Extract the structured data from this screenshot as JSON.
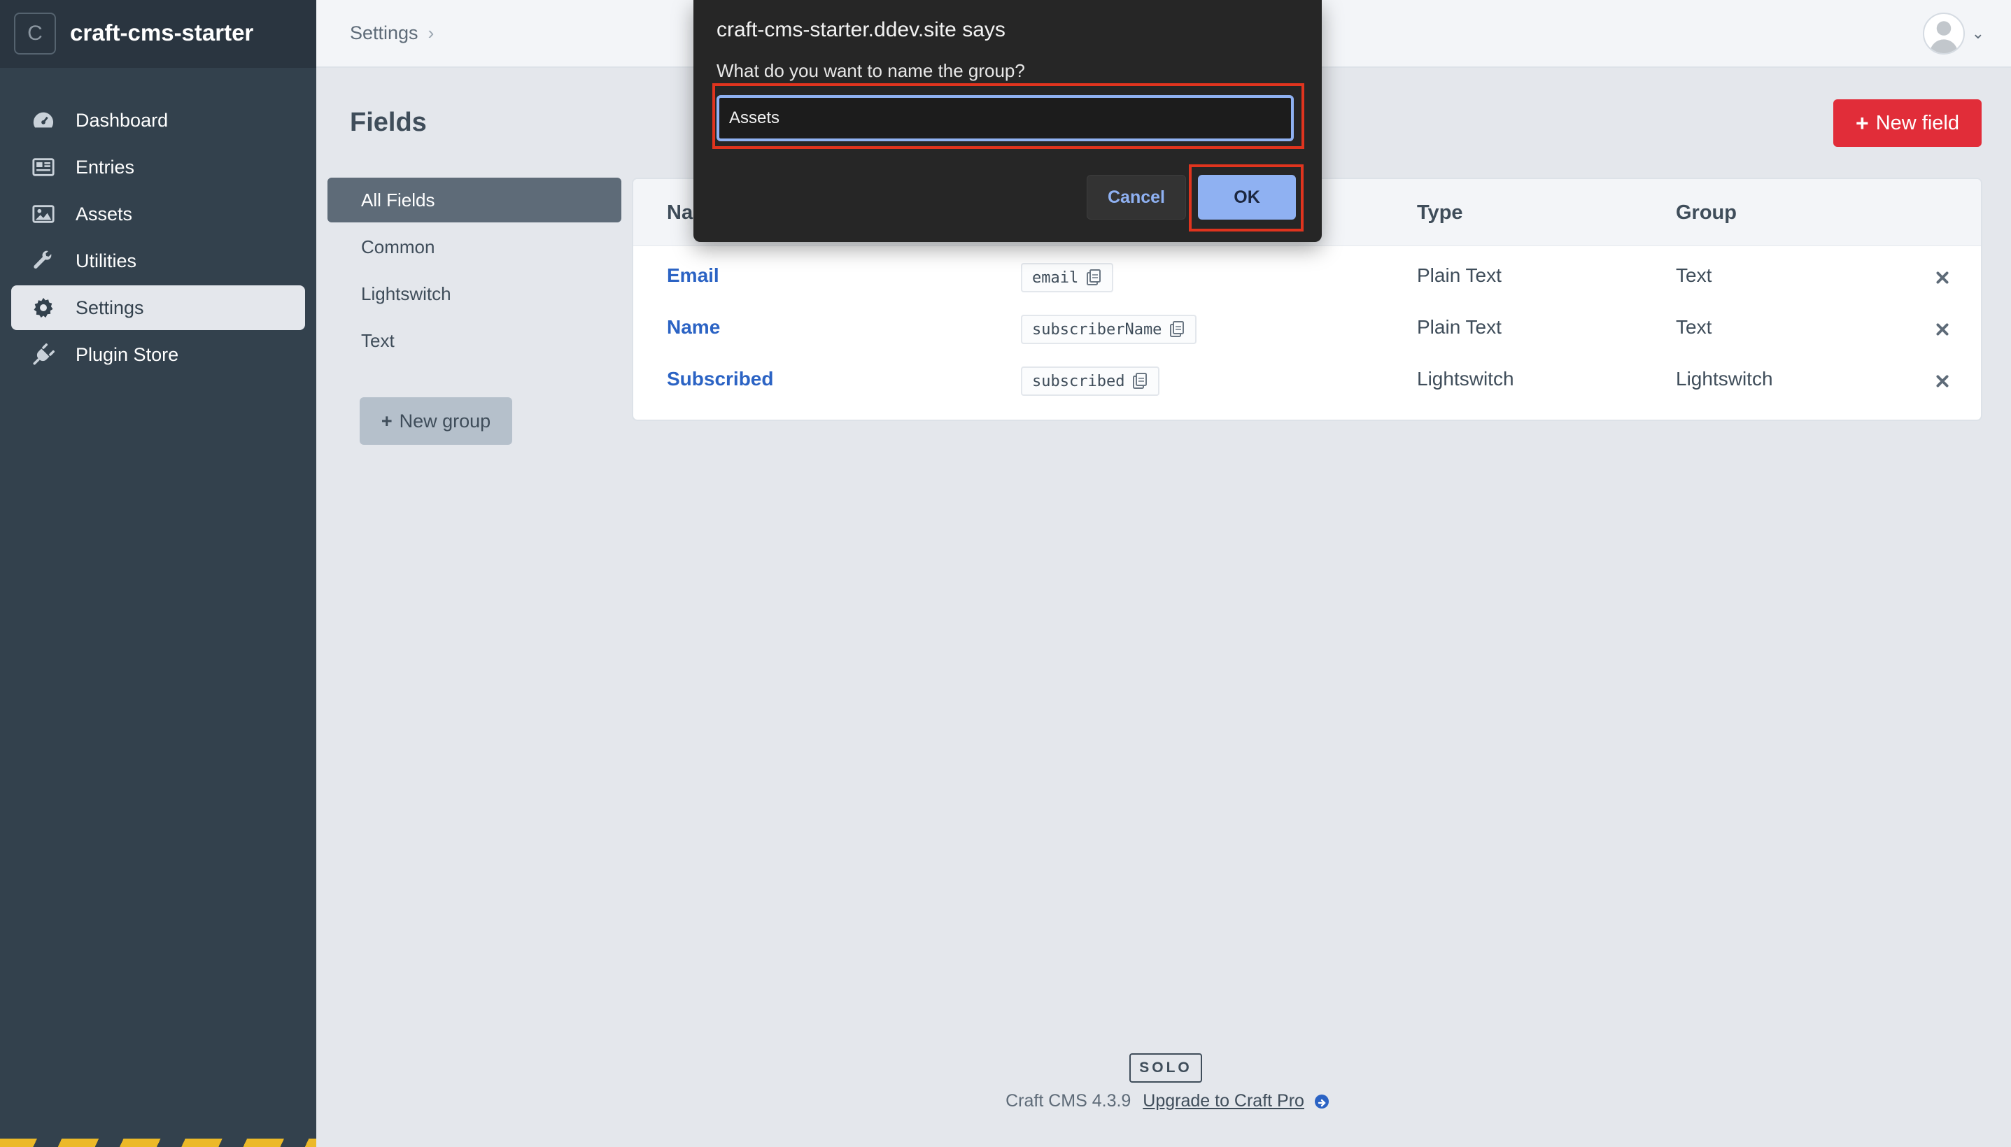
{
  "site": {
    "logo_letter": "C",
    "name": "craft-cms-starter"
  },
  "nav": {
    "items": [
      {
        "label": "Dashboard",
        "icon": "gauge-icon"
      },
      {
        "label": "Entries",
        "icon": "newspaper-icon"
      },
      {
        "label": "Assets",
        "icon": "image-icon"
      },
      {
        "label": "Utilities",
        "icon": "wrench-icon"
      },
      {
        "label": "Settings",
        "icon": "gear-icon",
        "active": true
      },
      {
        "label": "Plugin Store",
        "icon": "plug-icon"
      }
    ]
  },
  "breadcrumb": {
    "settings": "Settings"
  },
  "page": {
    "title": "Fields",
    "new_field_label": "New field"
  },
  "groups": {
    "items": [
      "All Fields",
      "Common",
      "Lightswitch",
      "Text"
    ],
    "active_index": 0,
    "new_group_label": "New group"
  },
  "table": {
    "headers": {
      "name": "Na",
      "type": "Type",
      "group": "Group"
    },
    "rows": [
      {
        "name": "Email",
        "handle": "email",
        "type": "Plain Text",
        "group": "Text"
      },
      {
        "name": "Name",
        "handle": "subscriberName",
        "type": "Plain Text",
        "group": "Text"
      },
      {
        "name": "Subscribed",
        "handle": "subscribed",
        "type": "Lightswitch",
        "group": "Lightswitch"
      }
    ]
  },
  "footer": {
    "edition": "SOLO",
    "version": "Craft CMS 4.3.9",
    "upgrade_label": "Upgrade to Craft Pro"
  },
  "dialog": {
    "title": "craft-cms-starter.ddev.site says",
    "message": "What do you want to name the group?",
    "input_value": "Assets",
    "cancel_label": "Cancel",
    "ok_label": "OK"
  },
  "colors": {
    "sidebar": "#33414d",
    "accent_red": "#e12d39",
    "link_blue": "#2b63c4",
    "highlight_frame": "#e0341e",
    "dialog_bg": "#262626",
    "dialog_button": "#8fb1f2"
  }
}
